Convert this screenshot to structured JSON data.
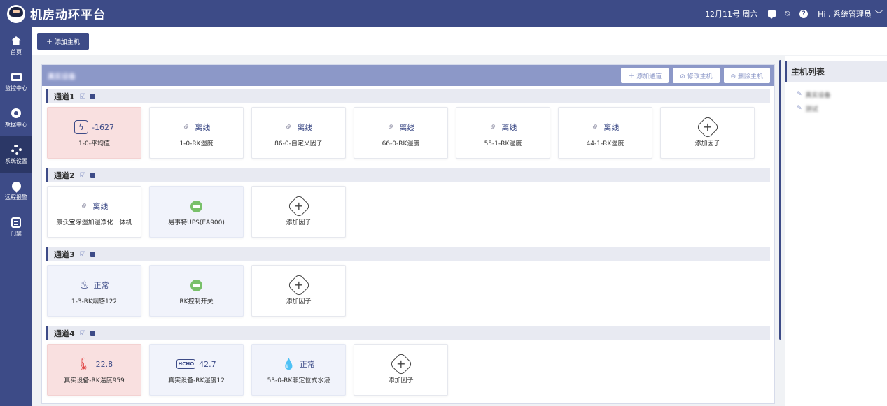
{
  "app": {
    "title": "机房动环平台"
  },
  "header": {
    "date": "12月11号 周六",
    "greeting": "Hi , 系统管理员"
  },
  "sidebar": {
    "items": [
      {
        "label": "首页",
        "icon": "home-icon"
      },
      {
        "label": "监控中心",
        "icon": "monitor-icon"
      },
      {
        "label": "数据中心",
        "icon": "data-icon"
      },
      {
        "label": "系统设置",
        "icon": "settings-icon",
        "active": true
      },
      {
        "label": "远程报警",
        "icon": "alarm-icon"
      },
      {
        "label": "门禁",
        "icon": "door-icon"
      }
    ]
  },
  "toolbar": {
    "add_host_label": "＋ 添加主机"
  },
  "device": {
    "name": "真实设备",
    "add_channel_label": "＋ 添加通道",
    "edit_host_label": "⊘ 修改主机",
    "delete_host_label": "⊖ 删除主机"
  },
  "channels": [
    {
      "name": "通道1",
      "cards": [
        {
          "kind": "bolt",
          "value": "-1627",
          "label": "1-0-平均值",
          "style": "alarm"
        },
        {
          "kind": "offline",
          "value": "离线",
          "label": "1-0-RK湿度"
        },
        {
          "kind": "offline",
          "value": "离线",
          "label": "86-0-自定义因子"
        },
        {
          "kind": "offline",
          "value": "离线",
          "label": "66-0-RK湿度"
        },
        {
          "kind": "offline",
          "value": "离线",
          "label": "55-1-RK湿度"
        },
        {
          "kind": "offline",
          "value": "离线",
          "label": "44-1-RK湿度"
        },
        {
          "kind": "add",
          "value": "",
          "label": "添加因子"
        }
      ]
    },
    {
      "name": "通道2",
      "cards": [
        {
          "kind": "offline",
          "value": "离线",
          "label": "康沃宝除湿加湿净化一体机"
        },
        {
          "kind": "ups",
          "value": "",
          "label": "易事特UPS(EA900)",
          "style": "blue"
        },
        {
          "kind": "add",
          "value": "",
          "label": "添加因子"
        }
      ]
    },
    {
      "name": "通道3",
      "cards": [
        {
          "kind": "smoke",
          "value": "正常",
          "label": "1-3-RK烟感122",
          "style": "blue"
        },
        {
          "kind": "ups",
          "value": "",
          "label": "RK控制开关",
          "style": "blue"
        },
        {
          "kind": "add",
          "value": "",
          "label": "添加因子"
        }
      ]
    },
    {
      "name": "通道4",
      "cards": [
        {
          "kind": "therm",
          "value": "22.8",
          "label": "真实设备-RK温度959",
          "style": "alarm"
        },
        {
          "kind": "hcho",
          "value": "42.7",
          "label": "真实设备-RK湿度12",
          "style": "blue"
        },
        {
          "kind": "water",
          "value": "正常",
          "label": "53-0-RK非定位式水浸",
          "style": "blue"
        },
        {
          "kind": "add",
          "value": "",
          "label": "添加因子"
        }
      ]
    }
  ],
  "host_list": {
    "title": "主机列表",
    "items": [
      "真实设备",
      "测试"
    ]
  }
}
